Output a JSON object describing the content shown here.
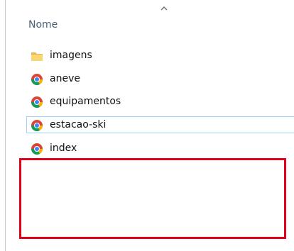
{
  "list": {
    "column_header": "Nome",
    "sort_icon": "chevron-up-icon",
    "items": [
      {
        "label": "imagens",
        "icon": "folder-icon"
      },
      {
        "label": "aneve",
        "icon": "chrome-icon"
      },
      {
        "label": "equipamentos",
        "icon": "chrome-icon"
      },
      {
        "label": "estacao-ski",
        "icon": "chrome-icon",
        "selected": true
      },
      {
        "label": "index",
        "icon": "chrome-icon"
      }
    ]
  },
  "colors": {
    "annotation_box": "#e3001b",
    "selection_border": "#99d1ff",
    "header_text": "#4c607a",
    "folder_yellow": "#f2c75c"
  }
}
